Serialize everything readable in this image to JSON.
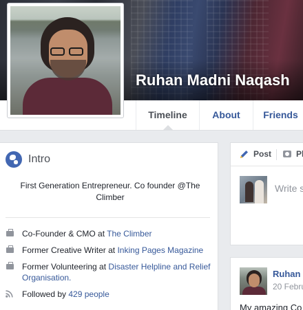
{
  "profile": {
    "name": "Ruhan Madni Naqash"
  },
  "tabs": [
    {
      "label": "Timeline"
    },
    {
      "label": "About"
    },
    {
      "label": "Friends"
    }
  ],
  "intro": {
    "title": "Intro",
    "bio": "First Generation Entrepreneur. Co founder @The Climber",
    "facts": [
      {
        "prefix": "Co-Founder & CMO at ",
        "link": "The Climber"
      },
      {
        "prefix": "Former Creative Writer at ",
        "link": "Inking Pages Magazine"
      },
      {
        "prefix": "Former Volunteering at ",
        "link": "Disaster Helpline and Relief Organisation."
      },
      {
        "prefix": "Followed by ",
        "link": "429 people"
      }
    ]
  },
  "composer": {
    "post_tab": "Post",
    "photo_tab": "Pl",
    "placeholder": "Write s"
  },
  "post": {
    "author": "Ruhan",
    "date": "20 Febru",
    "text": "My amazing Co"
  },
  "colors": {
    "link": "#365899",
    "accent": "#4267b2",
    "background": "#e9ebee"
  }
}
